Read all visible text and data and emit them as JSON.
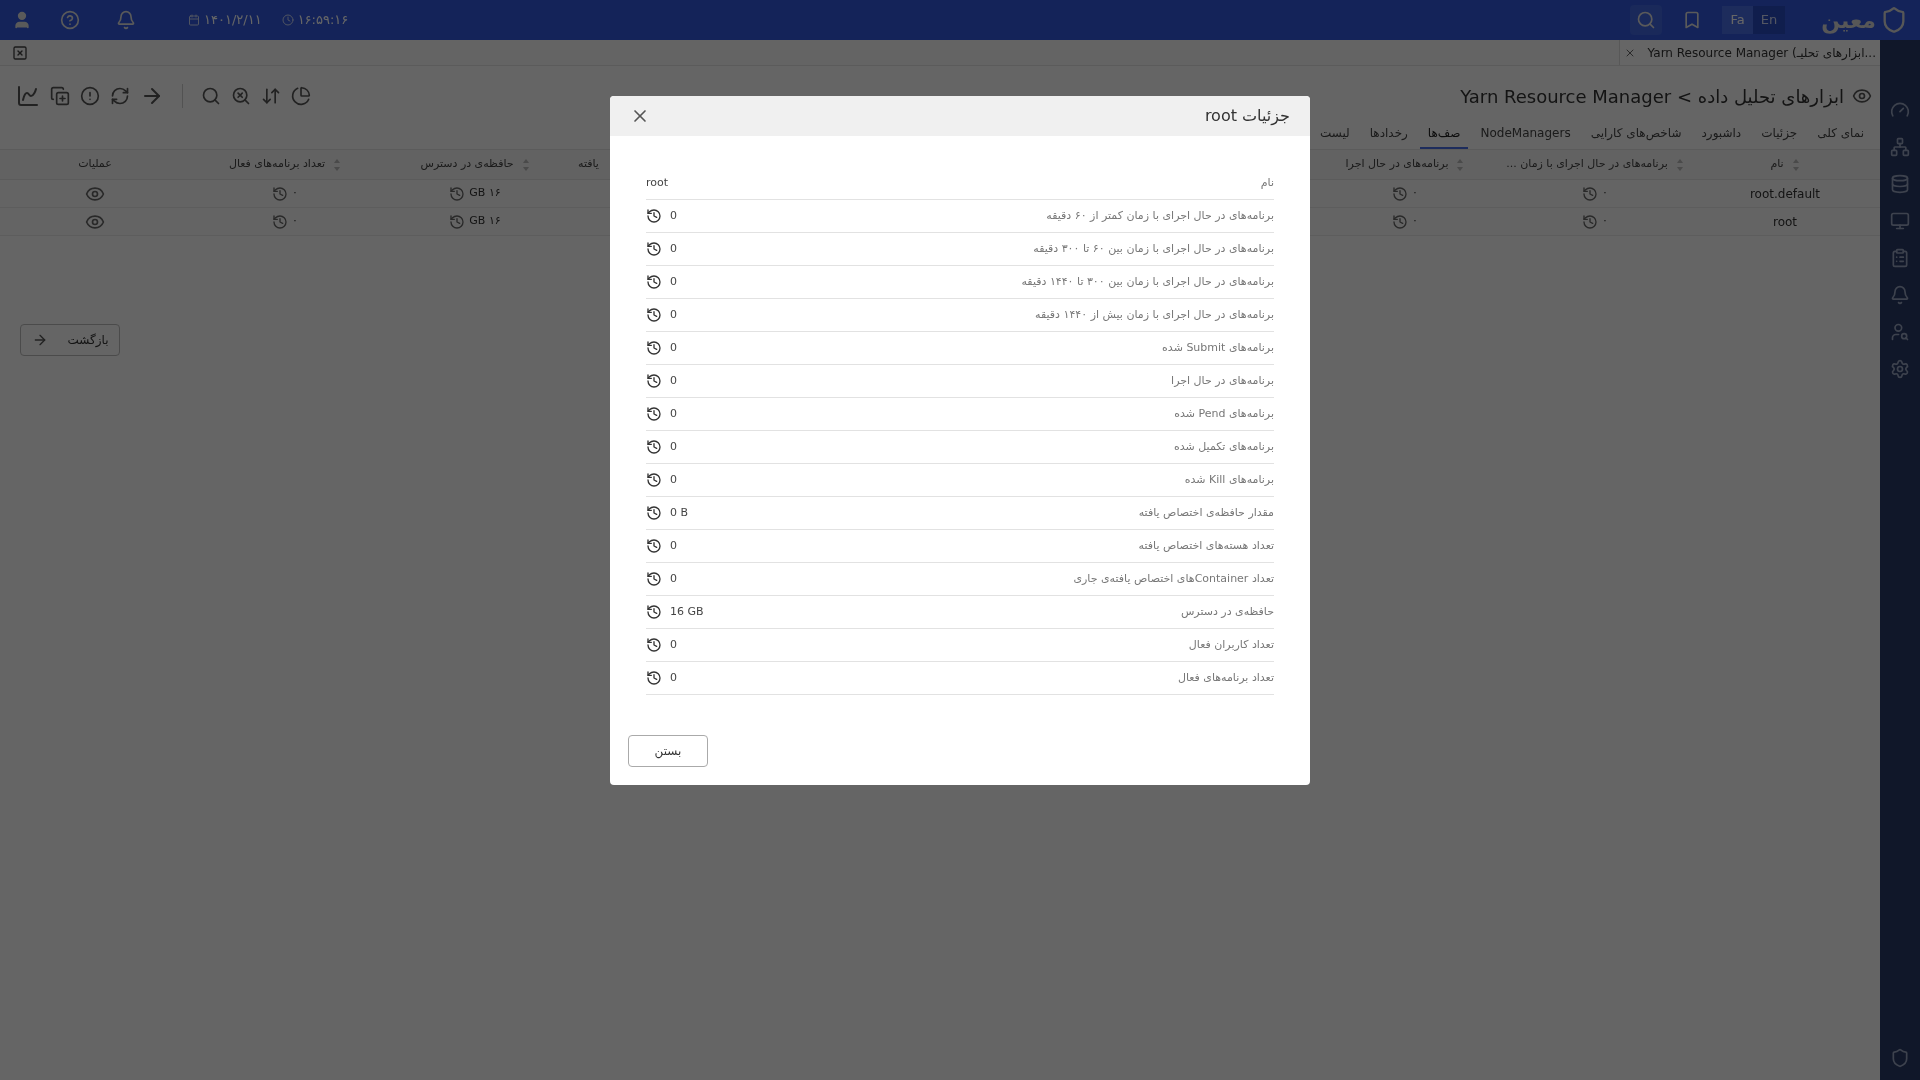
{
  "top_bar": {
    "logo": "معین",
    "languages": [
      {
        "label": "En",
        "selected": false
      },
      {
        "label": "Fa",
        "selected": true
      }
    ],
    "date": "۱۴۰۱/۲/۱۱",
    "time": "۱۶:۵۹:۱۶"
  },
  "open_tabs": [
    {
      "title": "Yarn Resource Manager (ابزارهای تحلیـ..."
    }
  ],
  "page": {
    "title": "ابزارهای تحلیل داده > Yarn Resource Manager",
    "tabs": [
      {
        "label": "نمای کلی",
        "selected": false
      },
      {
        "label": "جزئیات",
        "selected": false
      },
      {
        "label": "داشبورد",
        "selected": false
      },
      {
        "label": "شاخص‌های کارایی",
        "selected": false
      },
      {
        "label": "NodeManagers",
        "selected": false
      },
      {
        "label": "صف‌ها",
        "selected": true
      },
      {
        "label": "رخدادها",
        "selected": false
      },
      {
        "label": "لیست",
        "selected": false
      }
    ],
    "table": {
      "columns": [
        {
          "label": "نام",
          "kind": "name"
        },
        {
          "label": "برنامه‌های در حال اجرای با زمان ...",
          "kind": "value"
        },
        {
          "label": "برنامه‌های در حال اجرا",
          "kind": "value"
        },
        {
          "label": "یافته",
          "kind": "hidden"
        },
        {
          "label": "حافظه‌ی در دسترس",
          "kind": "value"
        },
        {
          "label": "تعداد برنامه‌های فعال",
          "kind": "value"
        },
        {
          "label": "عملیات",
          "kind": "action"
        }
      ],
      "rows": [
        {
          "cells": [
            "root.default",
            "۰",
            "۰",
            "",
            "۱۶ GB",
            "۰"
          ]
        },
        {
          "cells": [
            "root",
            "۰",
            "۰",
            "",
            "۱۶ GB",
            "۰"
          ]
        }
      ]
    },
    "back_button": "بازگشت"
  },
  "dialog": {
    "title": "جزئیات root",
    "header": {
      "label": "نام",
      "value": "root"
    },
    "rows": [
      {
        "label": "برنامه‌های در حال اجرای با زمان کمتر از ۶۰ دقیقه",
        "value": "0"
      },
      {
        "label": "برنامه‌های در حال اجرای با زمان بین ۶۰ تا ۳۰۰ دقیقه",
        "value": "0"
      },
      {
        "label": "برنامه‌های در حال اجرای با زمان بین ۳۰۰ تا ۱۴۴۰ دقیقه",
        "value": "0"
      },
      {
        "label": "برنامه‌های در حال اجرای با زمان بیش از ۱۴۴۰ دقیقه",
        "value": "0"
      },
      {
        "label": "برنامه‌های Submit شده",
        "value": "0"
      },
      {
        "label": "برنامه‌های در حال اجرا",
        "value": "0"
      },
      {
        "label": "برنامه‌های Pend شده",
        "value": "0"
      },
      {
        "label": "برنامه‌های تکمیل شده",
        "value": "0"
      },
      {
        "label": "برنامه‌های Kill شده",
        "value": "0"
      },
      {
        "label": "مقدار حافظه‌ی اختصاص یافته",
        "value": "0 B"
      },
      {
        "label": "تعداد هسته‌های اختصاص یافته",
        "value": "0"
      },
      {
        "label": "تعداد Containerهای اختصاص یافته‌ی جاری",
        "value": "0"
      },
      {
        "label": "حافظه‌ی در دسترس",
        "value": "16 GB"
      },
      {
        "label": "تعداد کاربران فعال",
        "value": "0"
      },
      {
        "label": "تعداد برنامه‌های فعال",
        "value": "0"
      }
    ],
    "close_button": "بستن"
  }
}
